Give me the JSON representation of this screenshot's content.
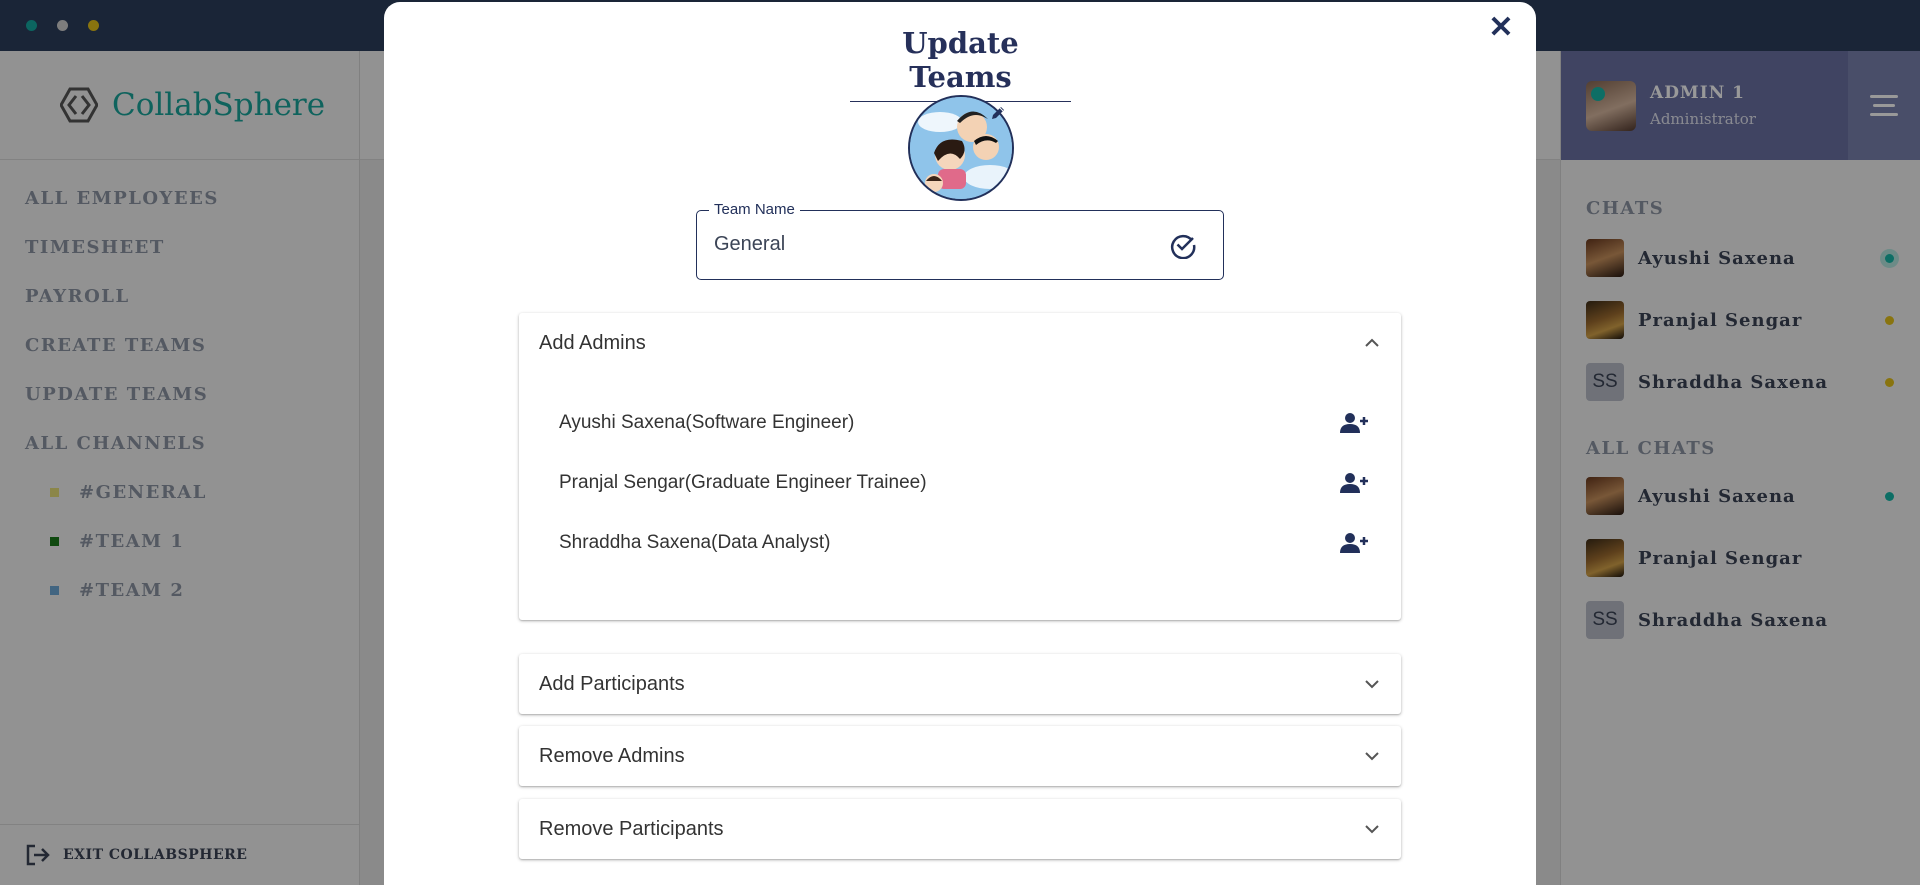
{
  "app": {
    "brand_name": "CollabSphere",
    "window_dots": [
      "#14a8a0",
      "#d0d0d0",
      "#e4c21a"
    ]
  },
  "sidebar": {
    "nav_items": [
      "ALL EMPLOYEES",
      "TIMESHEET",
      "PAYROLL",
      "CREATE TEAMS",
      "UPDATE TEAMS",
      "ALL CHANNELS"
    ],
    "channels": [
      {
        "label": "#GENERAL",
        "color": "#e8e07a"
      },
      {
        "label": "#TEAM 1",
        "color": "#1a7a1a"
      },
      {
        "label": "#TEAM 2",
        "color": "#6fa9d8"
      }
    ],
    "exit_label": "EXIT COLLABSPHERE"
  },
  "profile": {
    "name": "ADMIN 1",
    "role": "Administrator"
  },
  "chats": {
    "section_title": "CHATS",
    "items": [
      {
        "name": "Ayushi Saxena",
        "initials": "",
        "status_color": "#16b8a8"
      },
      {
        "name": "Pranjal Sengar",
        "initials": "",
        "status_color": "#e4c21a"
      },
      {
        "name": "Shraddha Saxena",
        "initials": "SS",
        "status_color": "#e4c21a"
      }
    ]
  },
  "all_chats": {
    "section_title": "ALL CHATS",
    "items": [
      {
        "name": "Ayushi Saxena",
        "initials": "",
        "status_color": "#16b8a8"
      },
      {
        "name": "Pranjal Sengar",
        "initials": "",
        "status_color": ""
      },
      {
        "name": "Shraddha Saxena",
        "initials": "SS",
        "status_color": ""
      }
    ]
  },
  "modal": {
    "title": "Update Teams",
    "close_label": "✕",
    "team_name_label": "Team Name",
    "team_name_value": "General",
    "accordions": [
      {
        "title": "Add Admins",
        "expanded": true
      },
      {
        "title": "Add Participants",
        "expanded": false
      },
      {
        "title": "Remove Admins",
        "expanded": false
      },
      {
        "title": "Remove Participants",
        "expanded": false
      }
    ],
    "add_admins_list": [
      "Ayushi Saxena(Software Engineer)",
      "Pranjal Sengar(Graduate Engineer Trainee)",
      "Shraddha Saxena(Data Analyst)"
    ]
  },
  "colors": {
    "accent": "#1aa59b",
    "navy": "#22305a",
    "profile_bg": "#6b72a3"
  }
}
